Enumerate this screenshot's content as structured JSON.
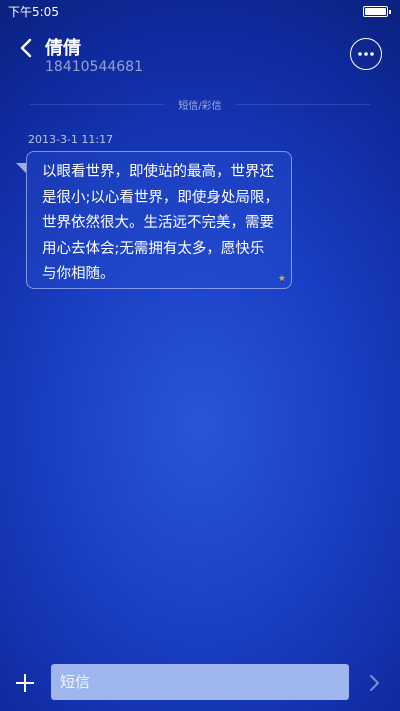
{
  "status_bar": {
    "time": "下午5:05"
  },
  "header": {
    "contact_name": "倩倩",
    "contact_number": "18410544681"
  },
  "conversation": {
    "message_type": "短信/彩信",
    "messages": [
      {
        "timestamp": "2013-3-1 11:17",
        "text": "以眼看世界，即使站的最高，世界还\n是很小;以心看世界，即使身处局限，\n世界依然很大。生活远不完美，需要\n用心去体会;无需拥有太多，愿快乐\n与你相随。",
        "star": "★"
      }
    ]
  },
  "compose": {
    "placeholder": "短信"
  },
  "colors": {
    "background": "#1a3fc4",
    "input_background": "#9fb5ee",
    "star": "#f0a020"
  },
  "icons": {
    "back": "chevron-left-icon",
    "more": "more-dots-icon",
    "add": "plus-icon",
    "send": "chevron-right-icon",
    "battery": "battery-icon"
  }
}
